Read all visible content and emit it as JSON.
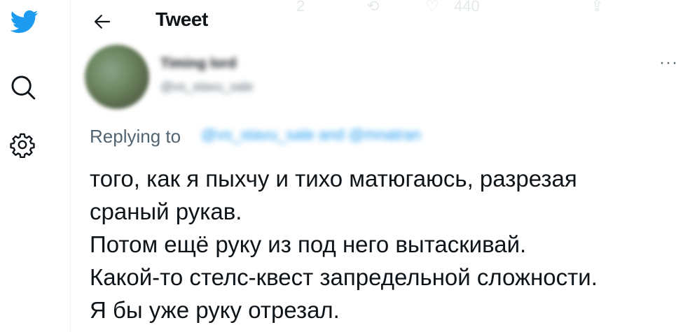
{
  "header": {
    "title": "Tweet"
  },
  "faded_actions": {
    "reply_count": "2",
    "like_count": "440"
  },
  "author": {
    "display_name": "Timing lord",
    "handle": "@vs_stavu_sale"
  },
  "reply_context": {
    "prefix": "Replying to",
    "handles": "@vs_stavu_sale and @mnatran"
  },
  "tweet": {
    "lines": [
      "того, как я пыхчу и тихо матюгаюсь, разрезая",
      "сраный рукав.",
      "Потом ещё руку из под него вытаскивай.",
      "Какой-то стелс-квест запредельной сложности.",
      "Я бы уже руку отрезал."
    ]
  },
  "icons": {
    "logo": "twitter-bird-icon",
    "search": "search-icon",
    "settings": "gear-icon",
    "back": "back-arrow-icon",
    "more": "more-icon"
  },
  "colors": {
    "brand": "#1d9bf0",
    "text": "#0f1419",
    "secondary": "#536471"
  }
}
